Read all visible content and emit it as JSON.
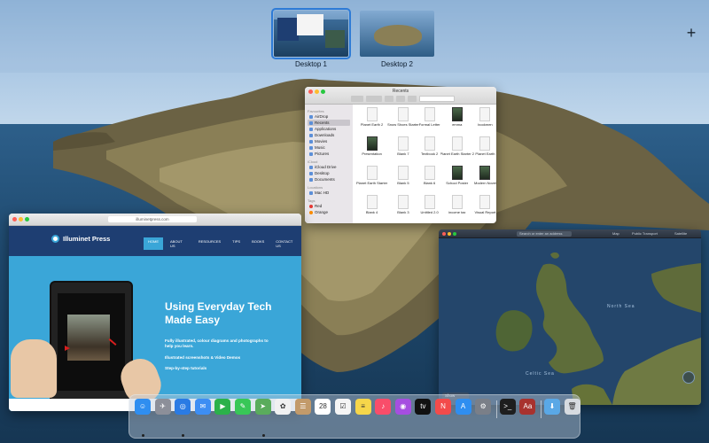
{
  "spaces": {
    "items": [
      {
        "label": "Desktop 1",
        "selected": true
      },
      {
        "label": "Desktop 2",
        "selected": false
      }
    ],
    "add_label": "+"
  },
  "finder": {
    "title": "Recents",
    "sidebar": {
      "favourites_heading": "Favourites",
      "favourites": [
        "AirDrop",
        "Recents",
        "Applications",
        "Downloads",
        "Movies",
        "Music",
        "Pictures"
      ],
      "icloud_heading": "iCloud",
      "icloud": [
        "iCloud Drive",
        "Desktop",
        "Documents"
      ],
      "locations_heading": "Locations",
      "locations": [
        "Mac HD"
      ],
      "tags_heading": "Tags",
      "tags": [
        {
          "name": "Red",
          "color": "#e53935"
        },
        {
          "name": "Orange",
          "color": "#fb8c00"
        }
      ]
    },
    "files": [
      {
        "name": "Planet Earth 2",
        "image": false
      },
      {
        "name": "Snow Shoes Starter",
        "image": false
      },
      {
        "name": "Formal Letter",
        "image": false
      },
      {
        "name": "emma",
        "image": true
      },
      {
        "name": "bookmen",
        "image": false
      },
      {
        "name": "Presentation",
        "image": true
      },
      {
        "name": "Blank 7",
        "image": false
      },
      {
        "name": "Textbook 2",
        "image": false
      },
      {
        "name": "Planet Earth Starter 2",
        "image": false
      },
      {
        "name": "Planet Earth",
        "image": false
      },
      {
        "name": "Planet Earth Starter",
        "image": false
      },
      {
        "name": "Blank 5",
        "image": false
      },
      {
        "name": "Blank 6",
        "image": false
      },
      {
        "name": "School Poster",
        "image": true
      },
      {
        "name": "Modern Novel",
        "image": true
      },
      {
        "name": "Blank 4",
        "image": false
      },
      {
        "name": "Blank 3",
        "image": false
      },
      {
        "name": "Untitled 2.0",
        "image": false
      },
      {
        "name": "income tax",
        "image": false
      },
      {
        "name": "Visual Report",
        "image": false
      }
    ]
  },
  "safari": {
    "address": "illuminetpress.com",
    "site": {
      "logo": "Illuminet Press",
      "nav": [
        "HOME",
        "ABOUT US",
        "RESOURCES",
        "TIPS",
        "BOOKS",
        "CONTACT US"
      ],
      "active_nav": "HOME",
      "headline": "Using Everyday Tech Made Easy",
      "points": [
        "Fully illustrated, colour diagrams and photographs to help you learn.",
        "Illustrated screenshots & Video Demos",
        "Step-by-step tutorials"
      ]
    }
  },
  "maps": {
    "search_placeholder": "Search or enter an address",
    "segments": [
      "Map",
      "Public Transport",
      "Satellite"
    ],
    "sea_labels": [
      "North Sea",
      "Celtic Sea"
    ],
    "show_button": "Show"
  },
  "dock": {
    "apps": [
      {
        "name": "finder-icon",
        "glyph": "☺",
        "color": "#2f8ef0",
        "running": true
      },
      {
        "name": "launchpad-icon",
        "glyph": "✈",
        "color": "#8c8f99",
        "running": false
      },
      {
        "name": "safari-icon",
        "glyph": "◎",
        "color": "#2a7be4",
        "running": true
      },
      {
        "name": "mail-icon",
        "glyph": "✉",
        "color": "#3d8ef3",
        "running": false
      },
      {
        "name": "facetime-icon",
        "glyph": "▶",
        "color": "#2bb14a",
        "running": false
      },
      {
        "name": "messages-icon",
        "glyph": "✎",
        "color": "#38c757",
        "running": false
      },
      {
        "name": "maps-icon",
        "glyph": "➤",
        "color": "#5aac5c",
        "running": true
      },
      {
        "name": "photos-icon",
        "glyph": "✿",
        "color": "#f1f1f1",
        "running": false
      },
      {
        "name": "contacts-icon",
        "glyph": "☰",
        "color": "#c29a6a",
        "running": false
      },
      {
        "name": "calendar-icon",
        "glyph": "28",
        "color": "#ffffff",
        "running": false
      },
      {
        "name": "reminders-icon",
        "glyph": "☑",
        "color": "#f5f5f5",
        "running": false
      },
      {
        "name": "notes-icon",
        "glyph": "≡",
        "color": "#f6d64a",
        "running": false
      },
      {
        "name": "music-icon",
        "glyph": "♪",
        "color": "#f94d6a",
        "running": false
      },
      {
        "name": "podcasts-icon",
        "glyph": "◉",
        "color": "#a64ee0",
        "running": false
      },
      {
        "name": "tv-icon",
        "glyph": "tv",
        "color": "#111111",
        "running": false
      },
      {
        "name": "news-icon",
        "glyph": "N",
        "color": "#f34b4b",
        "running": false
      },
      {
        "name": "app-store-icon",
        "glyph": "A",
        "color": "#2f8ef0",
        "running": false
      },
      {
        "name": "system-preferences-icon",
        "glyph": "⚙",
        "color": "#7a7f88",
        "running": false
      },
      {
        "name": "terminal-icon",
        "glyph": ">_",
        "color": "#1e1e1e",
        "running": false
      },
      {
        "name": "dictionary-icon",
        "glyph": "Aa",
        "color": "#a8322e",
        "running": false
      },
      {
        "name": "downloads-folder-icon",
        "glyph": "⬇",
        "color": "#5aa8e6",
        "running": false
      },
      {
        "name": "trash-icon",
        "glyph": "🗑",
        "color": "#d7dbe0",
        "running": false
      }
    ],
    "calendar_badge": "28",
    "syspref_badge": "1"
  }
}
